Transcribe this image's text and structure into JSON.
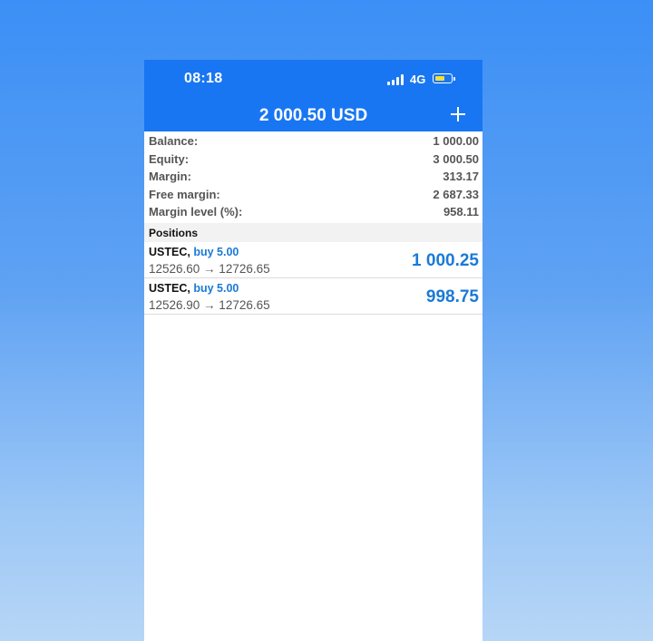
{
  "status_bar": {
    "time": "08:18",
    "network": "4G",
    "battery_color": "#f2e03a"
  },
  "header": {
    "title": "2 000.50 USD",
    "add_icon": "plus-icon"
  },
  "summary": [
    {
      "label": "Balance:",
      "value": "1 000.00"
    },
    {
      "label": "Equity:",
      "value": "3 000.50"
    },
    {
      "label": "Margin:",
      "value": "313.17"
    },
    {
      "label": "Free margin:",
      "value": "2 687.33"
    },
    {
      "label": "Margin level (%):",
      "value": "958.11"
    }
  ],
  "positions": {
    "header": "Positions",
    "items": [
      {
        "symbol": "USTEC,",
        "direction": "buy 5.00",
        "prices": "12526.60 → 12726.65",
        "profit": "1 000.25"
      },
      {
        "symbol": "USTEC,",
        "direction": "buy 5.00",
        "prices": "12526.90 → 12726.65",
        "profit": "998.75"
      }
    ]
  },
  "colors": {
    "accent": "#1976f2",
    "profit": "#1a7ad6"
  }
}
